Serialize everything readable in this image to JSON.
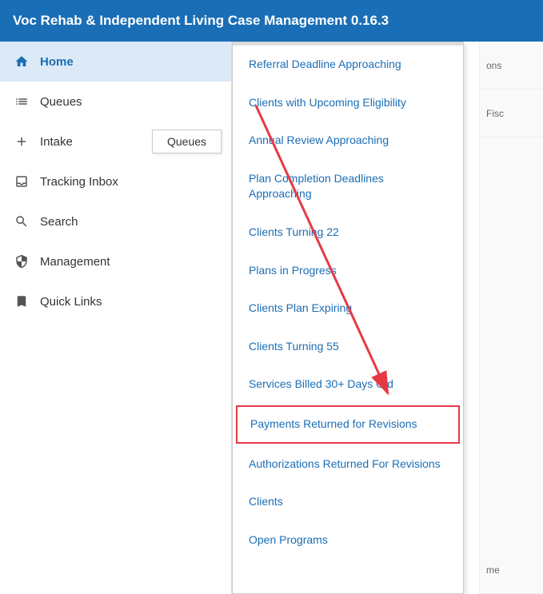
{
  "header": {
    "title": "Voc Rehab & Independent Living Case Management 0.16.3"
  },
  "sidebar": {
    "items": [
      {
        "id": "home",
        "label": "Home",
        "icon": "home",
        "active": true
      },
      {
        "id": "queues",
        "label": "Queues",
        "icon": "list",
        "active": false
      },
      {
        "id": "intake",
        "label": "Intake",
        "icon": "plus",
        "active": false
      },
      {
        "id": "tracking-inbox",
        "label": "Tracking Inbox",
        "icon": "inbox",
        "active": false
      },
      {
        "id": "search",
        "label": "Search",
        "icon": "search",
        "active": false
      },
      {
        "id": "management",
        "label": "Management",
        "icon": "shield",
        "active": false
      },
      {
        "id": "quick-links",
        "label": "Quick Links",
        "icon": "bookmark",
        "active": false
      }
    ],
    "queues_submenu_label": "Queues"
  },
  "dropdown": {
    "items": [
      {
        "id": "referral-deadline",
        "label": "Referral Deadline Approaching",
        "highlighted": false
      },
      {
        "id": "upcoming-eligibility",
        "label": "Clients with Upcoming Eligibility",
        "highlighted": false
      },
      {
        "id": "annual-review",
        "label": "Annual Review Approaching",
        "highlighted": false
      },
      {
        "id": "plan-completion",
        "label": "Plan Completion Deadlines Approaching",
        "highlighted": false
      },
      {
        "id": "clients-turning-22",
        "label": "Clients Turning 22",
        "highlighted": false
      },
      {
        "id": "plans-in-progress",
        "label": "Plans in Progress",
        "highlighted": false
      },
      {
        "id": "clients-plan-expiring",
        "label": "Clients Plan Expiring",
        "highlighted": false
      },
      {
        "id": "clients-turning-55",
        "label": "Clients Turning 55",
        "highlighted": false
      },
      {
        "id": "services-billed",
        "label": "Services Billed 30+ Days Old",
        "highlighted": false
      },
      {
        "id": "payments-returned",
        "label": "Payments Returned for Revisions",
        "highlighted": true
      },
      {
        "id": "authorizations-returned",
        "label": "Authorizations Returned For Revisions",
        "highlighted": false
      },
      {
        "id": "clients",
        "label": "Clients",
        "highlighted": false
      },
      {
        "id": "open-programs",
        "label": "Open Programs",
        "highlighted": false
      }
    ]
  },
  "right_partial": {
    "items": [
      "ons",
      "Fisc",
      "me"
    ]
  }
}
